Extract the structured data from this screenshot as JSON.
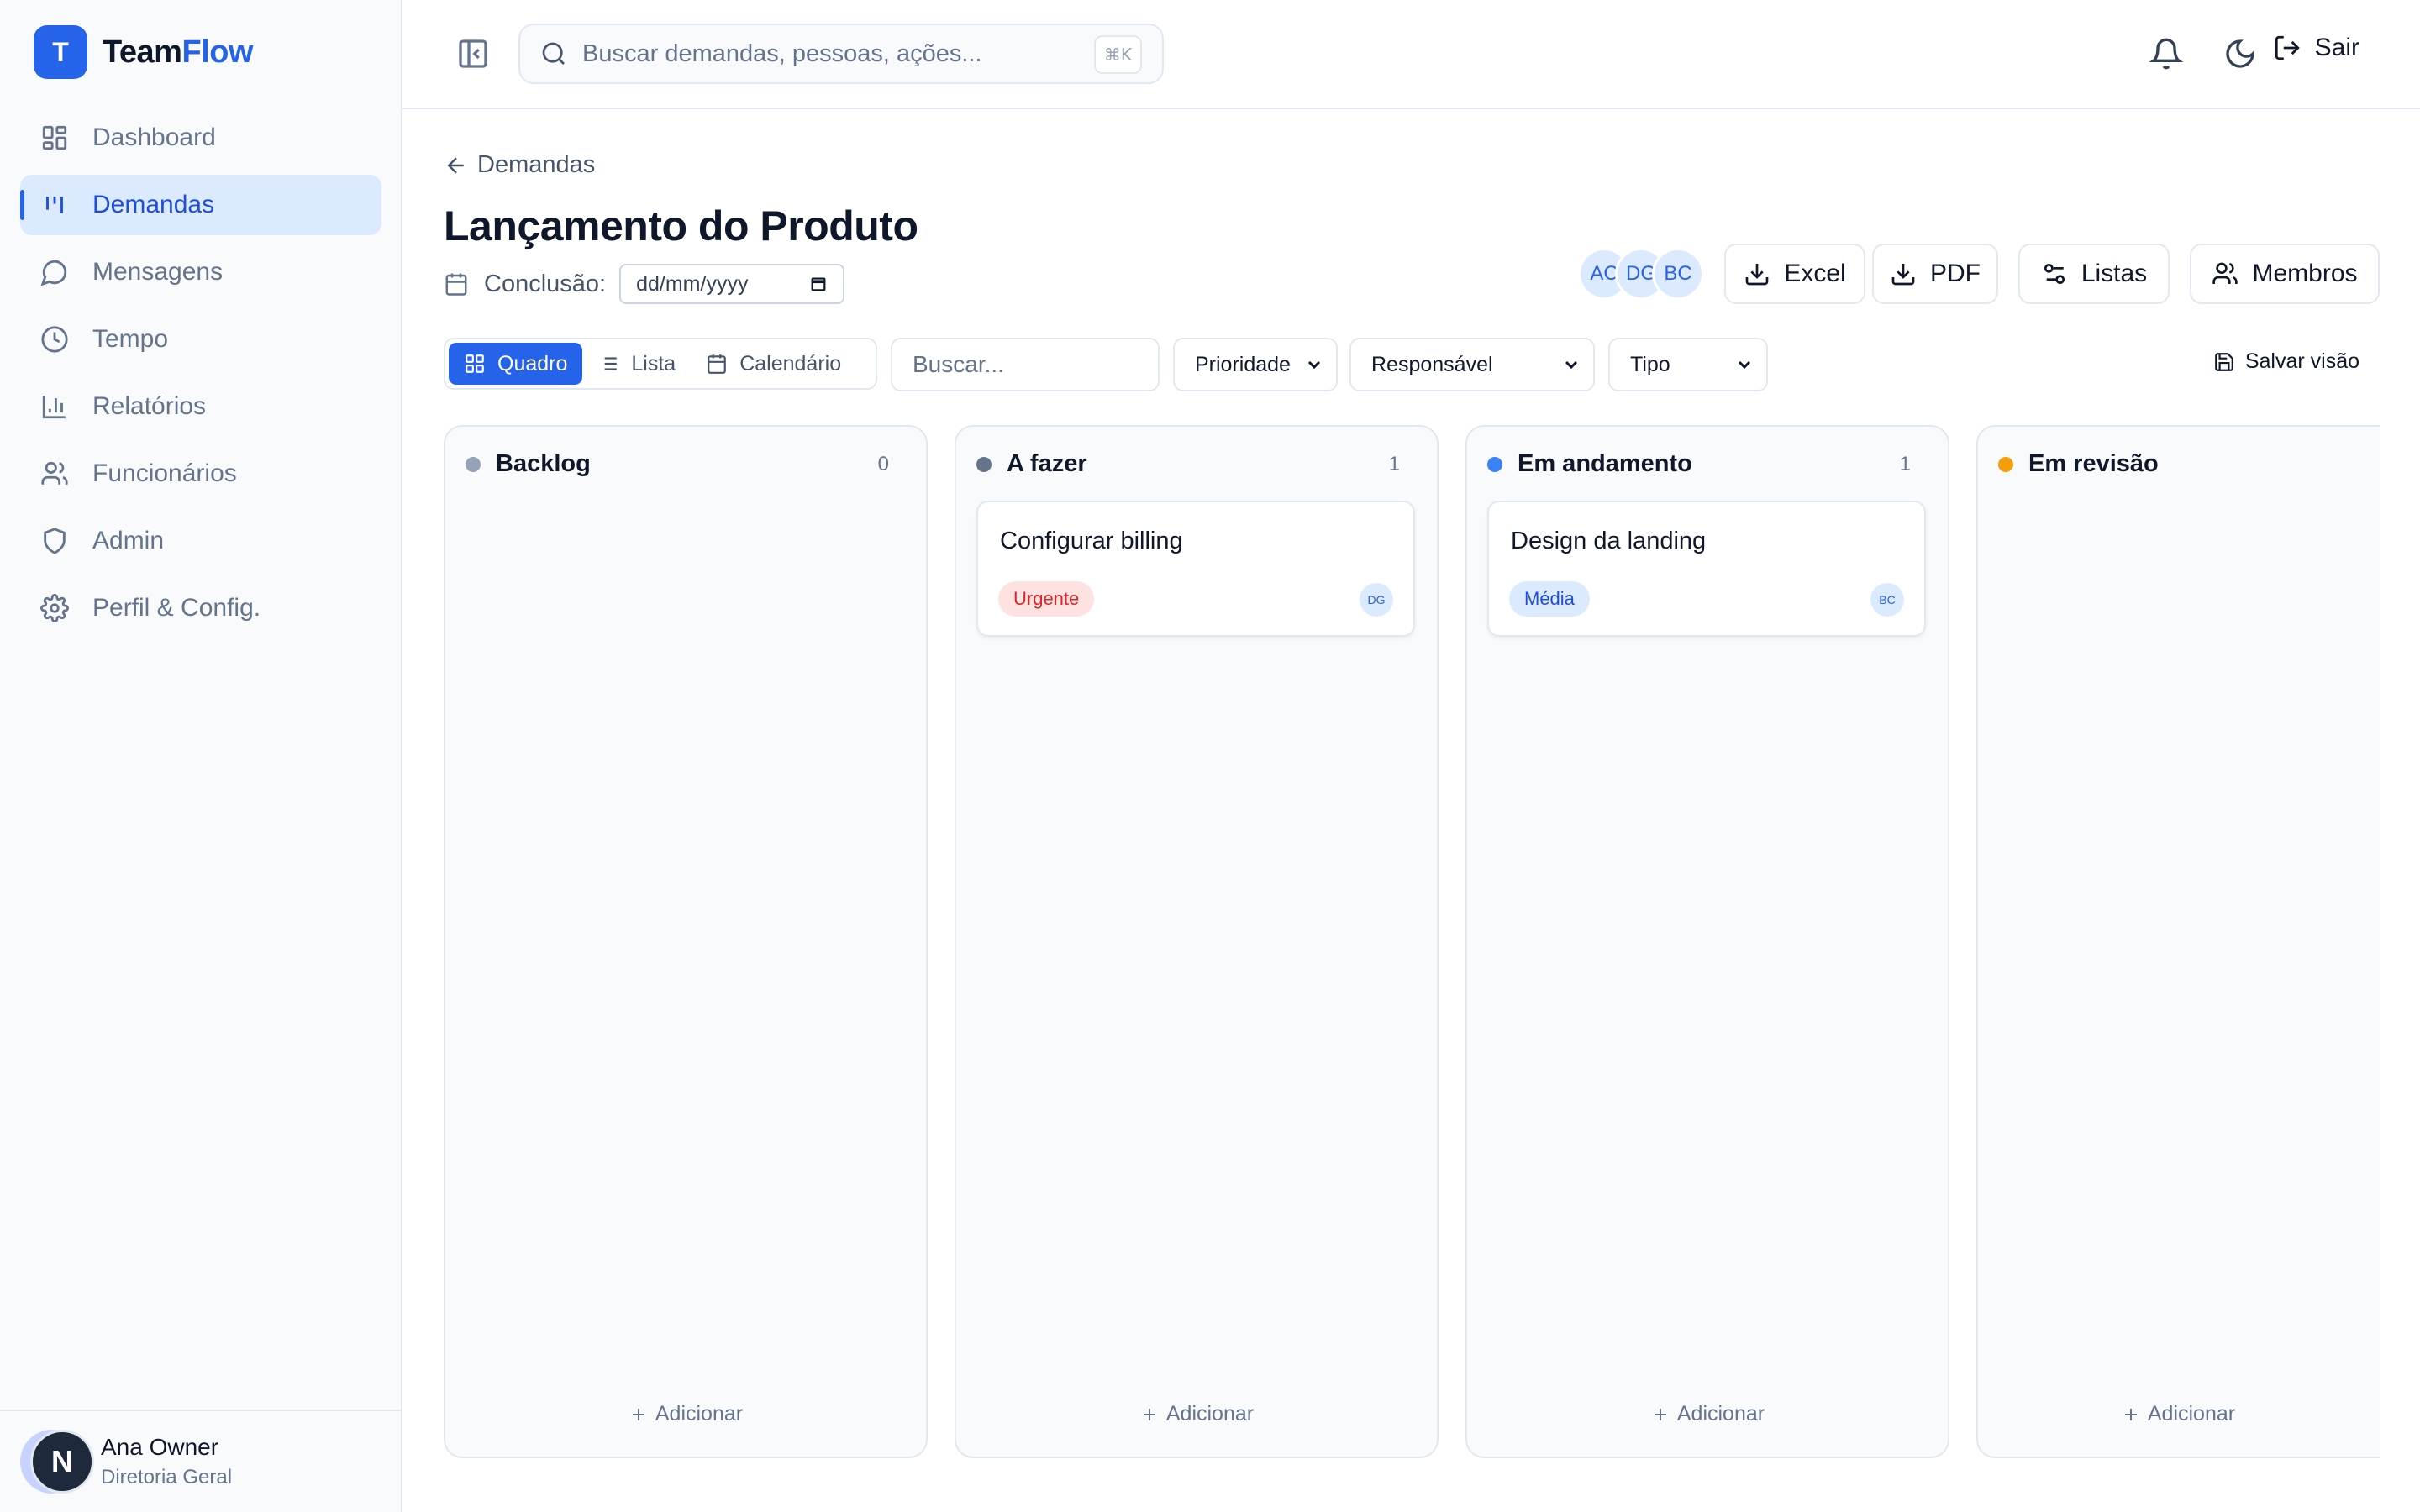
{
  "brand": {
    "logo_letter": "T",
    "name_part1": "Team",
    "name_part2": "Flow",
    "accent_color": "#2563eb"
  },
  "sidebar": {
    "items": [
      {
        "label": "Dashboard",
        "icon": "layout-dashboard-icon",
        "active": false
      },
      {
        "label": "Demandas",
        "icon": "kanban-icon",
        "active": true
      },
      {
        "label": "Mensagens",
        "icon": "message-circle-icon",
        "active": false
      },
      {
        "label": "Tempo",
        "icon": "clock-icon",
        "active": false
      },
      {
        "label": "Relatórios",
        "icon": "bar-chart-icon",
        "active": false
      },
      {
        "label": "Funcionários",
        "icon": "users-icon",
        "active": false
      },
      {
        "label": "Admin",
        "icon": "shield-icon",
        "active": false
      },
      {
        "label": "Perfil & Config.",
        "icon": "gear-icon",
        "active": false
      }
    ],
    "user": {
      "avatar_letter": "N",
      "name": "Ana Owner",
      "role": "Diretoria Geral"
    }
  },
  "topbar": {
    "search_placeholder": "Buscar demandas, pessoas, ações...",
    "shortcut": "⌘K",
    "logout_label": "Sair"
  },
  "page": {
    "back_label": "Demandas",
    "title": "Lançamento do Produto",
    "conclusion_label": "Conclusão:",
    "date_placeholder": "dd/mm/yyyy",
    "members": [
      "AC",
      "DG",
      "BC"
    ],
    "actions": {
      "excel": "Excel",
      "pdf": "PDF",
      "lists": "Listas",
      "members": "Membros"
    }
  },
  "toolbar": {
    "views": {
      "board": "Quadro",
      "list": "Lista",
      "calendar": "Calendário"
    },
    "search_placeholder": "Buscar...",
    "filters": {
      "priority": "Prioridade",
      "assignee": "Responsável",
      "type": "Tipo"
    },
    "save_view": "Salvar visão"
  },
  "board": {
    "add_label": "Adicionar",
    "columns": [
      {
        "title": "Backlog",
        "count": "0",
        "color": "#94a3b8"
      },
      {
        "title": "A fazer",
        "count": "1",
        "color": "#64748b",
        "card": {
          "title": "Configurar billing",
          "badge": "Urgente",
          "assignee": "DG"
        }
      },
      {
        "title": "Em andamento",
        "count": "1",
        "color": "#3b82f6",
        "card": {
          "title": "Design da landing",
          "badge": "Média",
          "assignee": "BC"
        }
      },
      {
        "title": "Em revisão",
        "count": "",
        "color": "#f59e0b"
      }
    ]
  }
}
